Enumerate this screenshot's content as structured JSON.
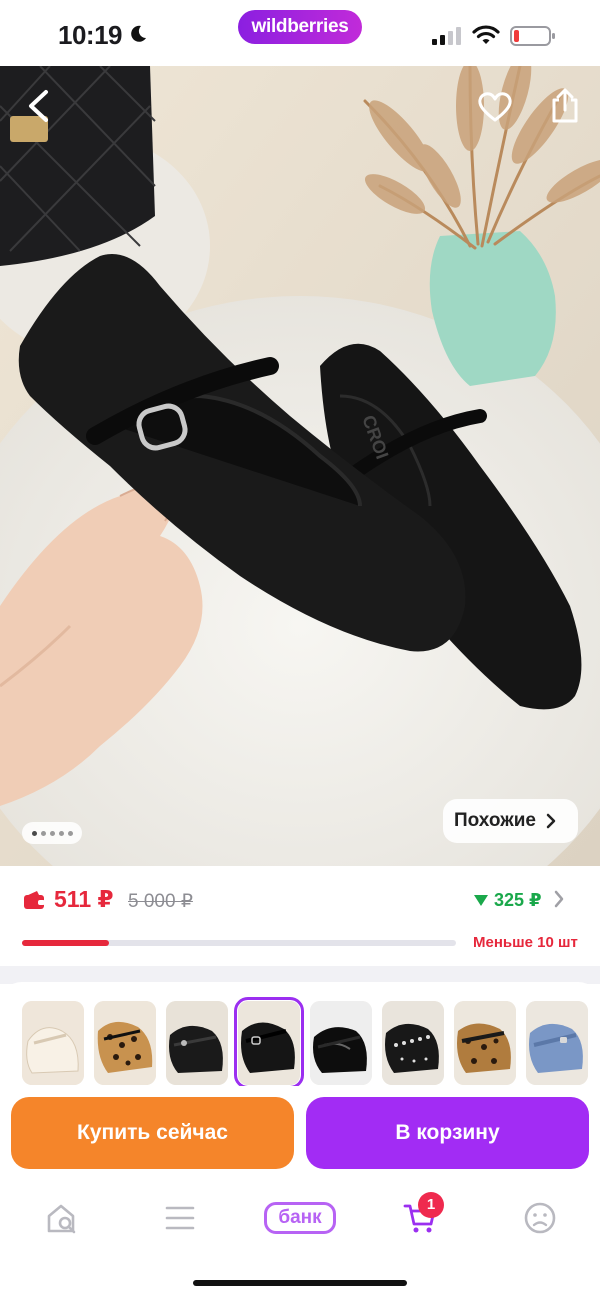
{
  "status_bar": {
    "time": "10:19",
    "brand": "wildberries"
  },
  "hero": {
    "photo_counter": {
      "total": 5,
      "active": 1
    },
    "similar_label": "Похожие",
    "icons": {
      "back": "chevron-left-icon",
      "favorite": "heart-icon",
      "share": "share-icon"
    }
  },
  "price": {
    "current": "511 ₽",
    "old": "5 000 ₽",
    "cashback": "325 ₽",
    "stock_label": "Меньше 10 шт",
    "stock_level": 0.2
  },
  "colors": {
    "price_red": "#e6283c",
    "cashback_green": "#1aa84b",
    "buy_orange": "#f5852a",
    "cart_purple": "#a22cf4",
    "brand_gradient_start": "#8b1fe0",
    "brand_gradient_end": "#c12bd9"
  },
  "thumbnails": {
    "count": 8,
    "selected_index": 3,
    "variants": [
      "cream",
      "leopard",
      "black-mesh",
      "black-suede",
      "black-patent",
      "black-studded",
      "leopard-strap",
      "denim-blue"
    ]
  },
  "actions": {
    "buy_now": "Купить сейчас",
    "add_to_cart": "В корзину"
  },
  "nav": {
    "items": [
      "home-search-icon",
      "menu-icon",
      "bank",
      "cart-icon",
      "profile-icon"
    ],
    "bank_label": "банк",
    "cart_badge": "1"
  }
}
